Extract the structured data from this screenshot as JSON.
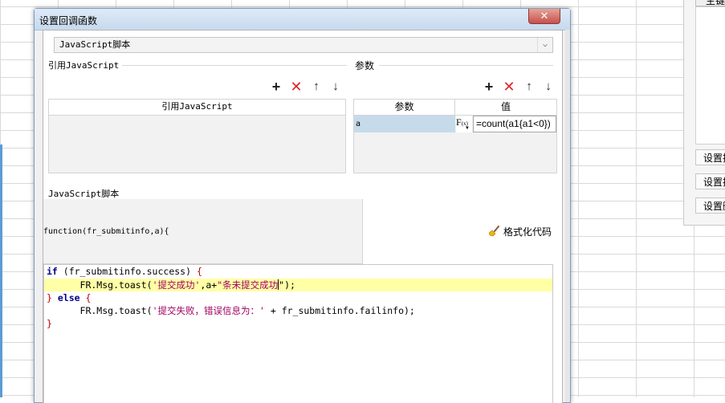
{
  "dialog": {
    "title": "设置回调函数",
    "close_glyph": "✕",
    "script_type_select": {
      "value": "JavaScript脚本",
      "arrow": "⌵"
    }
  },
  "ref_js": {
    "section_label": "引用JavaScript",
    "table_header": "引用JavaScript"
  },
  "params": {
    "section_label": "参数",
    "header_name": "参数",
    "header_value": "值",
    "rows": [
      {
        "name": "a",
        "value": "=count(a1{a1<0})"
      }
    ]
  },
  "toolbar": {
    "add_icon": "plus-icon",
    "delete_icon": "delete-icon",
    "up_icon": "arrow-up-icon",
    "down_icon": "arrow-down-icon"
  },
  "script": {
    "section_label": "JavaScript脚本",
    "signature": "function(fr_submitinfo,a){",
    "format_button": "格式化代码"
  },
  "code": {
    "line1": {
      "kw": "if",
      "a": " (fr_submitinfo.success) ",
      "b": "{"
    },
    "line2": {
      "indent": "      FR.Msg.toast(",
      "s1": "'提交成功'",
      "mid": ",a+",
      "s2": "\"条未提交成功",
      "end": "\");"
    },
    "line3": {
      "b1": "}",
      "kw": " else ",
      "b2": "{"
    },
    "line4": {
      "indent": "      FR.Msg.toast(",
      "s1": "'提交失败，错误信息为：'",
      "end": " + fr_submitinfo.failinfo);"
    },
    "line5": {
      "b": "}"
    }
  },
  "right_panel": {
    "header": "主键",
    "buttons": [
      "设置插",
      "设置插",
      "设置删"
    ]
  },
  "colors": {
    "title_bg": "#c7d9ee",
    "selected_row": "#c5dbea",
    "highlight_line": "#ffffa6",
    "delete_red": "#e0242b"
  }
}
